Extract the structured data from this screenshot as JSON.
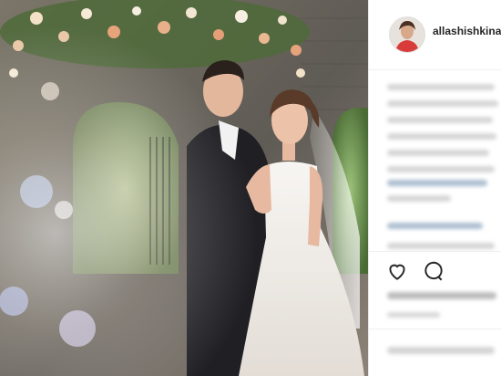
{
  "post": {
    "username": "allashishkina_",
    "photo_alt": "",
    "caption_lines": 7,
    "icons": [
      "heart-icon",
      "comment-icon"
    ]
  },
  "colors": {
    "username_text": "#262626",
    "border": "#efefef"
  }
}
